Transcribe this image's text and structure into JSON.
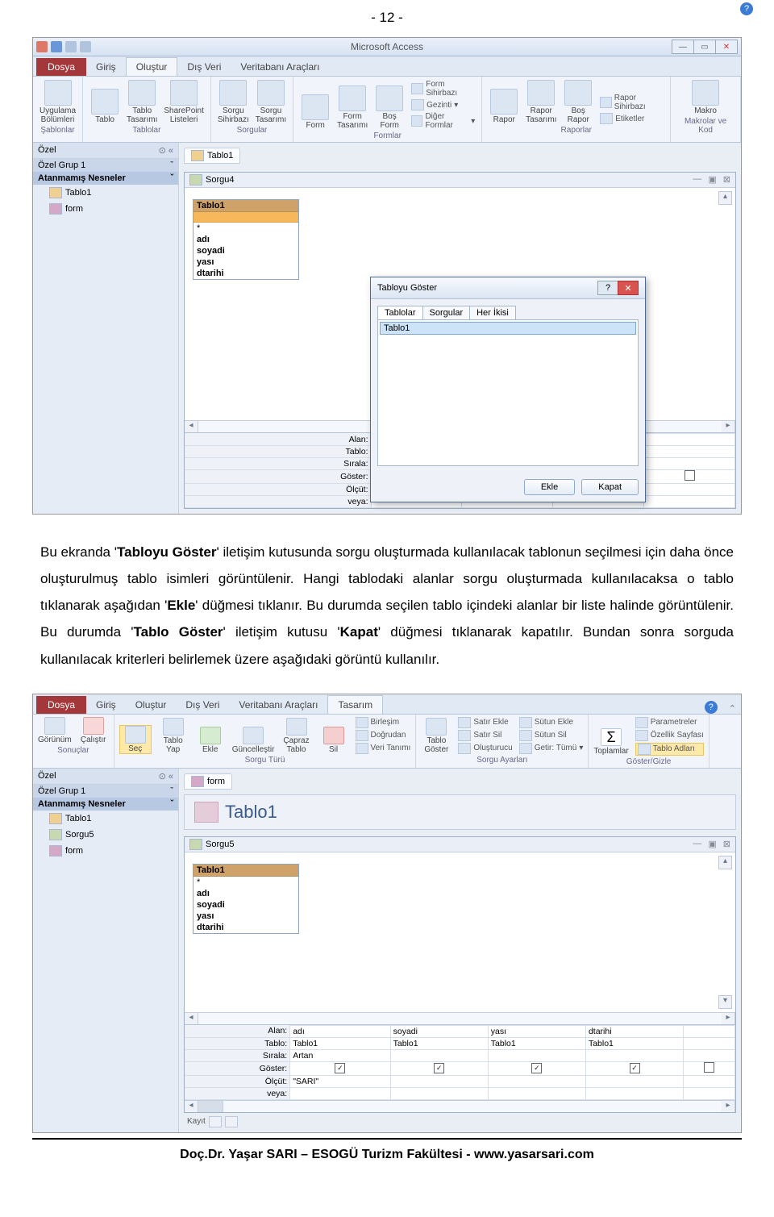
{
  "page_number": "- 12 -",
  "paragraph_parts": {
    "p1": "Bu ekranda '",
    "b1": "Tabloyu Göster",
    "p2": "' iletişim kutusunda sorgu oluşturmada kullanılacak tablonun seçilmesi için daha önce oluşturulmuş tablo isimleri görüntülenir. Hangi tablodaki alanlar sorgu oluşturmada kullanılacaksa o tablo tıklanarak aşağıdan '",
    "b2": "Ekle",
    "p3": "' düğmesi tıklanır. Bu durumda seçilen tablo içindeki alanlar bir liste halinde görüntülenir. Bu durumda '",
    "b3": "Tablo Göster",
    "p4": "' iletişim kutusu '",
    "b4": "Kapat",
    "p5": "' düğmesi tıklanarak kapatılır. Bundan sonra sorguda kullanılacak kriterleri belirlemek üzere aşağıdaki görüntü kullanılır."
  },
  "footer": "Doç.Dr. Yaşar SARI – ESOGÜ Turizm Fakültesi - www.yasarsari.com",
  "shot1": {
    "app_title": "Microsoft Access",
    "file_tab": "Dosya",
    "tabs": [
      "Giriş",
      "Oluştur",
      "Dış Veri",
      "Veritabanı Araçları"
    ],
    "active_tab": "Oluştur",
    "groups": {
      "sablonlar": {
        "label": "Şablonlar",
        "btn": "Uygulama\nBölümleri"
      },
      "tablolar": {
        "label": "Tablolar",
        "btns": [
          "Tablo",
          "Tablo\nTasarımı",
          "SharePoint\nListeleri"
        ]
      },
      "sorgular": {
        "label": "Sorgular",
        "btns": [
          "Sorgu\nSihirbazı",
          "Sorgu\nTasarımı"
        ]
      },
      "formlar": {
        "label": "Formlar",
        "btns": [
          "Form",
          "Form\nTasarımı",
          "Boş\nForm"
        ],
        "links": [
          "Form Sihirbazı",
          "Gezinti",
          "Diğer Formlar"
        ]
      },
      "raporlar": {
        "label": "Raporlar",
        "btns": [
          "Rapor",
          "Rapor\nTasarımı",
          "Boş\nRapor"
        ],
        "links": [
          "Rapor Sihirbazı",
          "Etiketler"
        ]
      },
      "makrolar": {
        "label": "Makrolar ve Kod",
        "btn": "Makro"
      }
    },
    "nav": {
      "header": "Özel",
      "group1": "Özel Grup 1",
      "group2": "Atanmamış Nesneler",
      "items": [
        "Tablo1",
        "form"
      ]
    },
    "doc_tab": "Tablo1",
    "sub_tab": "Sorgu4",
    "table_box": {
      "title": "Tablo1",
      "fields": [
        "*",
        "adı",
        "soyadi",
        "yası",
        "dtarihi"
      ]
    },
    "dialog": {
      "title": "Tabloyu Göster",
      "tabs": [
        "Tablolar",
        "Sorgular",
        "Her İkisi"
      ],
      "item": "Tablo1",
      "btn_add": "Ekle",
      "btn_close": "Kapat"
    },
    "qgrid_labels": [
      "Alan:",
      "Tablo:",
      "Sırala:",
      "Göster:",
      "Ölçüt:",
      "veya:"
    ]
  },
  "shot2": {
    "file_tab": "Dosya",
    "tabs": [
      "Giriş",
      "Oluştur",
      "Dış Veri",
      "Veritabanı Araçları",
      "Tasarım"
    ],
    "active_tab": "Tasarım",
    "groups": {
      "sonuclar": {
        "label": "Sonuçlar",
        "btns": [
          "Görünüm",
          "Çalıştır"
        ]
      },
      "sorgu_turu": {
        "label": "Sorgu Türü",
        "btns": [
          "Seç",
          "Tablo\nYap",
          "Ekle",
          "Güncelleştir",
          "Çapraz\nTablo",
          "Sil"
        ],
        "links": [
          "Birleşim",
          "Doğrudan",
          "Veri Tanımı"
        ]
      },
      "sorgu_ayarlari": {
        "label": "Sorgu Ayarları",
        "main": "Tablo\nGöster",
        "links_l": [
          "Satır Ekle",
          "Satır Sil",
          "Oluşturucu"
        ],
        "links_r": [
          "Sütun Ekle",
          "Sütun Sil",
          "Getir: Tümü"
        ]
      },
      "goster_gizle": {
        "label": "Göster/Gizle",
        "btn": "Toplamlar",
        "links": [
          "Parametreler",
          "Özellik Sayfası",
          "Tablo Adları"
        ]
      }
    },
    "nav": {
      "header": "Özel",
      "group1": "Özel Grup 1",
      "group2": "Atanmamış Nesneler",
      "items": [
        "Tablo1",
        "Sorgu5",
        "form"
      ]
    },
    "form_tab": "form",
    "form_title": "Tablo1",
    "sub_tab": "Sorgu5",
    "table_box": {
      "title": "Tablo1",
      "fields": [
        "*",
        "adı",
        "soyadi",
        "yası",
        "dtarihi"
      ]
    },
    "kayit_label": "Kayıt",
    "qgrid_labels": [
      "Alan:",
      "Tablo:",
      "Sırala:",
      "Göster:",
      "Ölçüt:",
      "veya:"
    ],
    "qgrid_data": {
      "alan": [
        "adı",
        "soyadi",
        "yası",
        "dtarihi"
      ],
      "tablo": [
        "Tablo1",
        "Tablo1",
        "Tablo1",
        "Tablo1"
      ],
      "sirala": [
        "Artan",
        "",
        "",
        ""
      ],
      "olcut": [
        "\"SARI\"",
        "",
        "",
        ""
      ]
    }
  }
}
